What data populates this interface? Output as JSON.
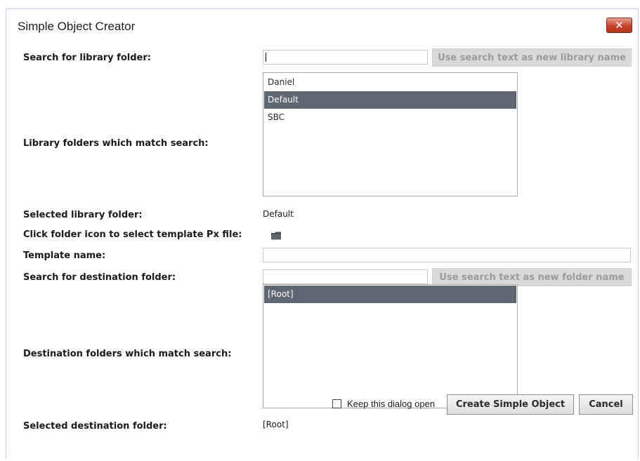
{
  "dialog": {
    "title": "Simple Object Creator",
    "close_icon": "close-x-icon"
  },
  "library_search": {
    "label": "Search for library folder:",
    "value": "",
    "button_label": "Use search text as new library name"
  },
  "library_list": {
    "label": "Library folders which match search:",
    "items": [
      "Daniel",
      "Default",
      "SBC"
    ],
    "selected": "Default"
  },
  "selected_library": {
    "label": "Selected library folder:",
    "value": "Default"
  },
  "template": {
    "label": "Click folder icon to select template Px file:",
    "icon": "folder-icon"
  },
  "template_name": {
    "label": "Template name:",
    "value": ""
  },
  "destination_search": {
    "label": "Search for destination folder:",
    "value": "",
    "button_label": "Use search text as new folder name"
  },
  "destination_list": {
    "label": "Destination folders which match search:",
    "items": [
      "[Root]"
    ],
    "selected": "[Root]"
  },
  "selected_destination": {
    "label": "Selected destination folder:",
    "value": "[Root]"
  },
  "footer": {
    "keep_open_label": "Keep this dialog open",
    "keep_open_checked": false,
    "create_label": "Create Simple Object",
    "cancel_label": "Cancel"
  },
  "colors": {
    "selection": "#5e6672",
    "close_button": "#c6432b"
  }
}
